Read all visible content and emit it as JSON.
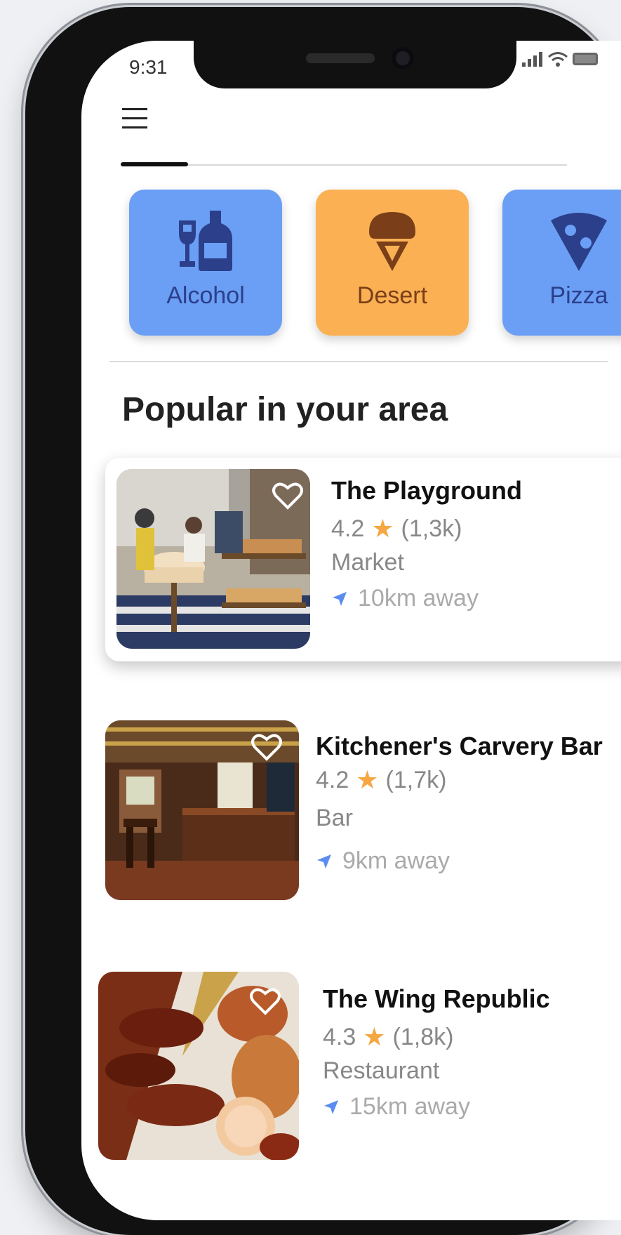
{
  "status_bar": {
    "time": "9:31"
  },
  "categories": [
    {
      "label": "Alcohol",
      "color": "#6b9ff5",
      "icon": "bottle-glass-icon"
    },
    {
      "label": "Desert",
      "color": "#fbb153",
      "icon": "ice-cream-icon"
    },
    {
      "label": "Pizza",
      "color": "#6b9ff5",
      "icon": "pizza-slice-icon"
    }
  ],
  "section_title": "Popular in your area",
  "places": [
    {
      "name": "The Playground",
      "rating": "4.2",
      "reviews": "(1,3k)",
      "type": "Market",
      "distance": "10km away",
      "favorited": false
    },
    {
      "name": "Kitchener's Carvery Bar",
      "rating": "4.2",
      "reviews": "(1,7k)",
      "type": "Bar",
      "distance": "9km away",
      "favorited": false
    },
    {
      "name": "The Wing Republic",
      "rating": "4.3",
      "reviews": "(1,8k)",
      "type": "Restaurant",
      "distance": "15km away",
      "favorited": false
    }
  ],
  "colors": {
    "accent_blue": "#6b9ff5",
    "accent_orange": "#fbb153",
    "star": "#f5a742",
    "icon_dark": "#2b3f8a"
  }
}
